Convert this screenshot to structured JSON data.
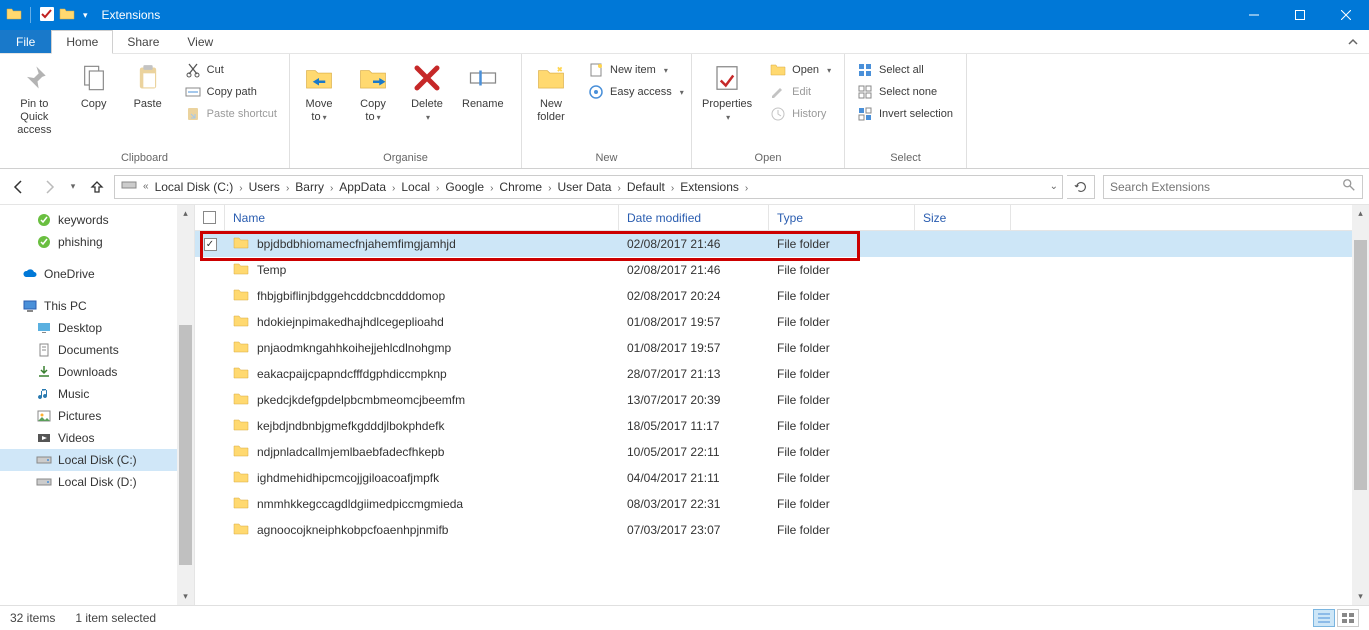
{
  "window": {
    "title": "Extensions"
  },
  "ribbon_tabs": {
    "file": "File",
    "home": "Home",
    "share": "Share",
    "view": "View"
  },
  "ribbon": {
    "clipboard": {
      "label": "Clipboard",
      "pin": "Pin to Quick\naccess",
      "copy": "Copy",
      "paste": "Paste",
      "cut": "Cut",
      "copypath": "Copy path",
      "pasteshortcut": "Paste shortcut"
    },
    "organise": {
      "label": "Organise",
      "moveto": "Move\nto",
      "copyto": "Copy\nto",
      "delete": "Delete",
      "rename": "Rename"
    },
    "new": {
      "label": "New",
      "newfolder": "New\nfolder",
      "newitem": "New item",
      "easyaccess": "Easy access"
    },
    "open": {
      "label": "Open",
      "properties": "Properties",
      "open": "Open",
      "edit": "Edit",
      "history": "History"
    },
    "select": {
      "label": "Select",
      "all": "Select all",
      "none": "Select none",
      "invert": "Invert selection"
    }
  },
  "breadcrumbs": [
    "Local Disk (C:)",
    "Users",
    "Barry",
    "AppData",
    "Local",
    "Google",
    "Chrome",
    "User Data",
    "Default",
    "Extensions"
  ],
  "search": {
    "placeholder": "Search Extensions"
  },
  "nav_items": [
    {
      "label": "keywords",
      "icon": "green-check",
      "indent": 1
    },
    {
      "label": "phishing",
      "icon": "green-check",
      "indent": 1
    },
    {
      "label": "",
      "spacer": true
    },
    {
      "label": "OneDrive",
      "icon": "onedrive",
      "indent": 0
    },
    {
      "label": "",
      "spacer": true
    },
    {
      "label": "This PC",
      "icon": "pc",
      "indent": 0
    },
    {
      "label": "Desktop",
      "icon": "desktop",
      "indent": 1
    },
    {
      "label": "Documents",
      "icon": "documents",
      "indent": 1
    },
    {
      "label": "Downloads",
      "icon": "downloads",
      "indent": 1
    },
    {
      "label": "Music",
      "icon": "music",
      "indent": 1
    },
    {
      "label": "Pictures",
      "icon": "pictures",
      "indent": 1
    },
    {
      "label": "Videos",
      "icon": "videos",
      "indent": 1
    },
    {
      "label": "Local Disk (C:)",
      "icon": "disk",
      "indent": 1,
      "selected": true
    },
    {
      "label": "Local Disk (D:)",
      "icon": "disk",
      "indent": 1
    }
  ],
  "columns": {
    "name": "Name",
    "date": "Date modified",
    "type": "Type",
    "size": "Size"
  },
  "files": [
    {
      "name": "bpjdbdbhiomamecfnjahemfimgjamhjd",
      "date": "02/08/2017 21:46",
      "type": "File folder",
      "selected": true
    },
    {
      "name": "Temp",
      "date": "02/08/2017 21:46",
      "type": "File folder"
    },
    {
      "name": "fhbjgbiflinjbdggehcddcbncdddomop",
      "date": "02/08/2017 20:24",
      "type": "File folder"
    },
    {
      "name": "hdokiejnpimakedhajhdlcegeplioahd",
      "date": "01/08/2017 19:57",
      "type": "File folder"
    },
    {
      "name": "pnjaodmkngahhkoihejjehlcdlnohgmp",
      "date": "01/08/2017 19:57",
      "type": "File folder"
    },
    {
      "name": "eakacpaijcpapndcfffdgphdiccmpknp",
      "date": "28/07/2017 21:13",
      "type": "File folder"
    },
    {
      "name": "pkedcjkdefgpdelpbcmbmeomcjbeemfm",
      "date": "13/07/2017 20:39",
      "type": "File folder"
    },
    {
      "name": "kejbdjndbnbjgmefkgdddjlbokphdefk",
      "date": "18/05/2017 11:17",
      "type": "File folder"
    },
    {
      "name": "ndjpnladcallmjemlbaebfadecfhkepb",
      "date": "10/05/2017 22:11",
      "type": "File folder"
    },
    {
      "name": "ighdmehidhipcmcojjgiloacoafjmpfk",
      "date": "04/04/2017 21:11",
      "type": "File folder"
    },
    {
      "name": "nmmhkkegccagdldgiimedpiccmgmieda",
      "date": "08/03/2017 22:31",
      "type": "File folder"
    },
    {
      "name": "agnoocojkneiphkobpcfoaenhpjnmifb",
      "date": "07/03/2017 23:07",
      "type": "File folder"
    }
  ],
  "status": {
    "count": "32 items",
    "selected": "1 item selected"
  }
}
